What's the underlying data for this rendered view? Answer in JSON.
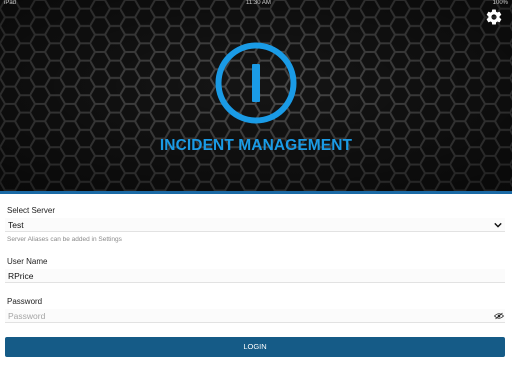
{
  "status_bar": {
    "left": "iPad",
    "center": "11:30 AM",
    "right": "100%"
  },
  "app": {
    "title": "INCIDENT MANAGEMENT",
    "accent_color": "#1a9be6",
    "button_color": "#155b87",
    "logo_icon": "info-circle-icon",
    "settings_icon": "gear-icon"
  },
  "form": {
    "server": {
      "label": "Select Server",
      "value": "Test",
      "hint": "Server Aliases can be added in Settings"
    },
    "username": {
      "label": "User Name",
      "value": "RPrice"
    },
    "password": {
      "label": "Password",
      "placeholder": "Password",
      "value": ""
    },
    "login_label": "LOGIN"
  }
}
